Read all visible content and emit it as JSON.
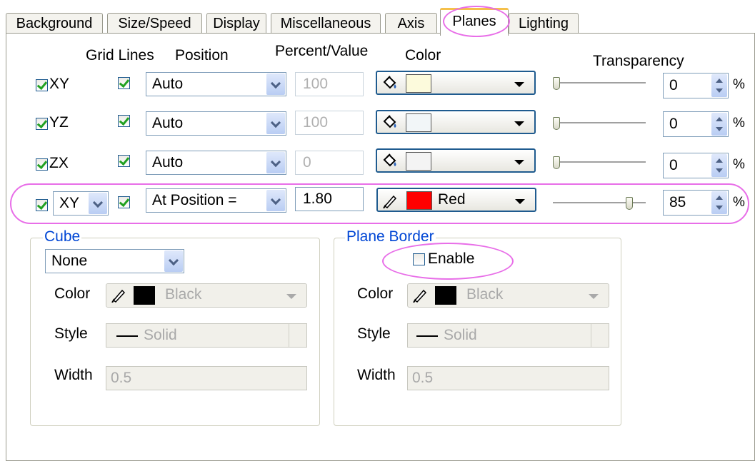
{
  "tabs": [
    "Background",
    "Size/Speed",
    "Display",
    "Miscellaneous",
    "Axis",
    "Planes",
    "Lighting"
  ],
  "headers": {
    "grid_lines": "Grid Lines",
    "position": "Position",
    "percent_value": "Percent/Value",
    "color": "Color",
    "transparency": "Transparency"
  },
  "planes": [
    {
      "label": "XY",
      "checked": true,
      "grid_checked": true,
      "position": "Auto",
      "value": "100",
      "value_enabled": false,
      "color_hex": "#fcfadc",
      "color_name": "",
      "transparency": "0",
      "slider_level": 0
    },
    {
      "label": "YZ",
      "checked": true,
      "grid_checked": true,
      "position": "Auto",
      "value": "100",
      "value_enabled": false,
      "color_hex": "#f2f6f8",
      "color_name": "",
      "transparency": "0",
      "slider_level": 0
    },
    {
      "label": "ZX",
      "checked": true,
      "grid_checked": true,
      "position": "Auto",
      "value": "0",
      "value_enabled": false,
      "color_hex": "#f4f4f4",
      "color_name": "",
      "transparency": "0",
      "slider_level": 0
    }
  ],
  "extra_plane": {
    "checked": true,
    "selector": "XY",
    "grid_checked": true,
    "position": "At Position =",
    "value": "1.80",
    "color_hex": "#ff0000",
    "color_name": "Red",
    "transparency": "85",
    "slider_level": 0.85
  },
  "percent_sign": "%",
  "cube": {
    "legend": "Cube",
    "value": "None",
    "color_label": "Color",
    "color_name": "Black",
    "color_hex": "#000000",
    "style_label": "Style",
    "style_value": "Solid",
    "width_label": "Width",
    "width_value": "0.5"
  },
  "plane_border": {
    "legend": "Plane Border",
    "enable_label": "Enable",
    "enabled": false,
    "color_label": "Color",
    "color_name": "Black",
    "color_hex": "#000000",
    "style_label": "Style",
    "style_value": "Solid",
    "width_label": "Width",
    "width_value": "0.5"
  },
  "colors": {
    "highlight": "#e86ee8",
    "group_legend": "#0046d5",
    "active_tab_accent": "#f5c04a"
  },
  "icons": {
    "fill": "paint-bucket-icon",
    "line": "pen-icon"
  }
}
